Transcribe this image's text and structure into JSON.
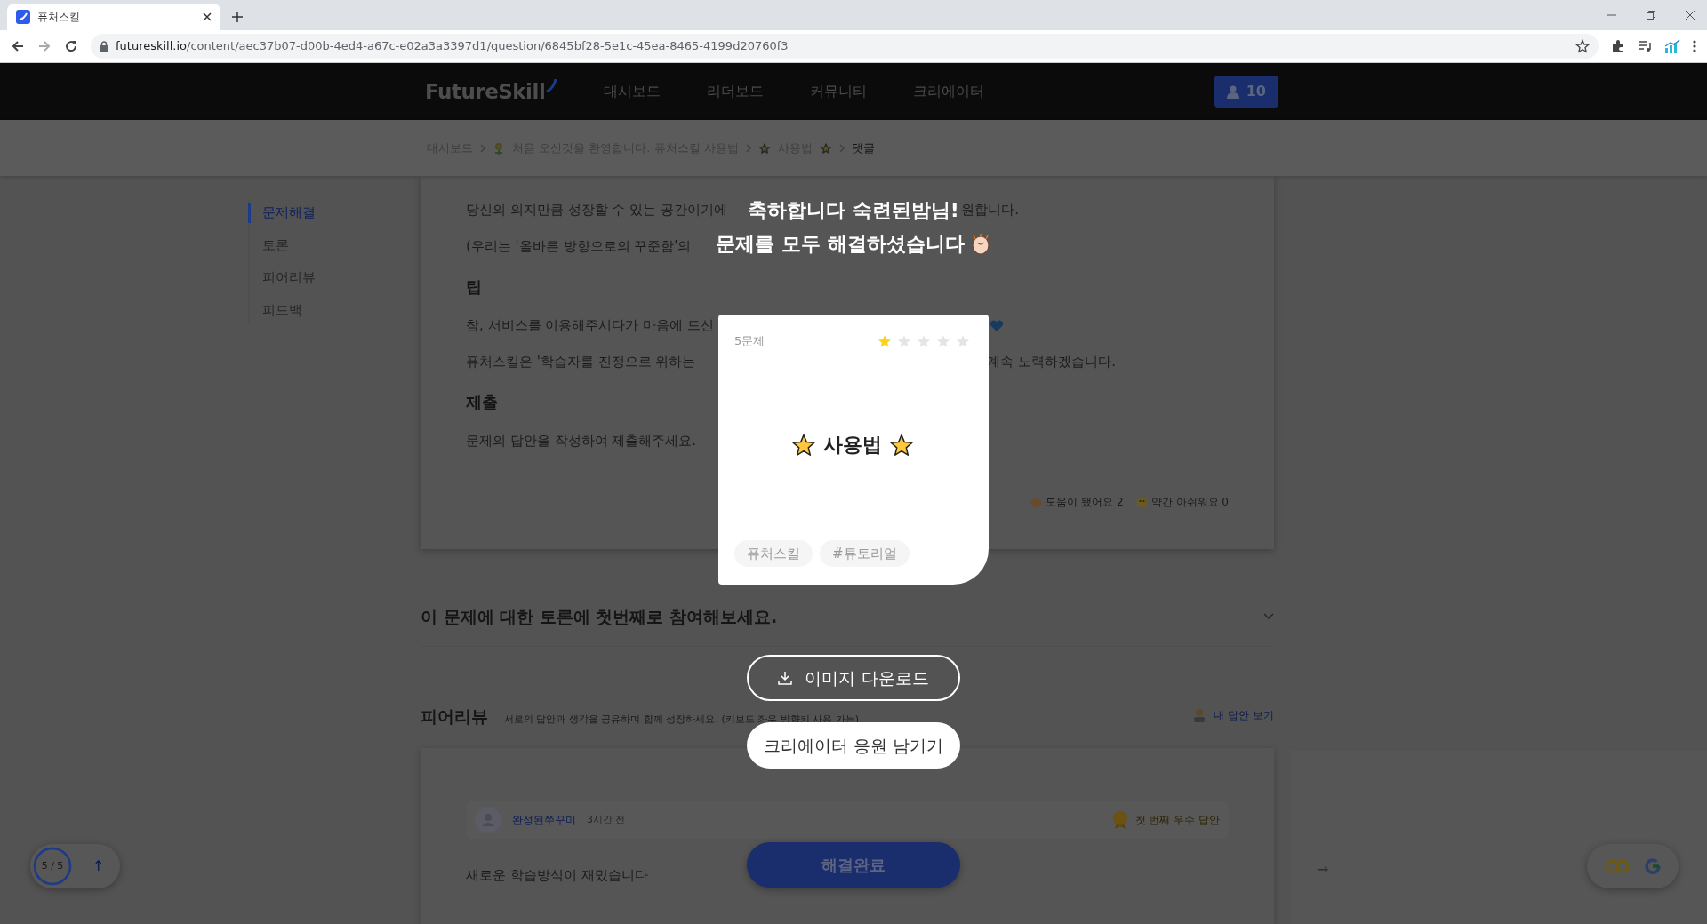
{
  "browser": {
    "tab_title": "퓨처스킬",
    "url_host": "futureskill.io",
    "url_path": "/content/aec37b07-d00b-4ed4-a67c-e02a3a3397d1/question/6845bf28-5e1c-45ea-8465-4199d20760f3"
  },
  "header": {
    "logo": "FutureSkill",
    "nav": [
      "대시보드",
      "리더보드",
      "커뮤니티",
      "크리에이터"
    ],
    "points": "10"
  },
  "breadcrumb": [
    {
      "text": "대시보드",
      "kind": "plain",
      "current": false
    },
    {
      "text": "처음 오신것을 환영합니다. 퓨처스킬 사용법",
      "kind": "flower",
      "current": false
    },
    {
      "text": "사용법",
      "kind": "starred",
      "current": false
    },
    {
      "text": "댓글",
      "kind": "plain",
      "current": true
    }
  ],
  "side_nav": [
    {
      "label": "문제해결",
      "selected": true
    },
    {
      "label": "토론",
      "selected": false
    },
    {
      "label": "피어리뷰",
      "selected": false
    },
    {
      "label": "피드백",
      "selected": false
    }
  ],
  "content": {
    "lines": [
      {
        "kind": "split",
        "left": "당신의 의지만큼 성장할 수 있는 공간이기에",
        "right": "원합니다."
      },
      {
        "kind": "text",
        "text": "(우리는 '올바른 방향으로의 꾸준함'의"
      },
      {
        "kind": "heading",
        "text": "팁"
      },
      {
        "kind": "heart",
        "text": "참, 서비스를 이용해주시다가 마음에 드신"
      },
      {
        "kind": "split",
        "left": "퓨처스킬은 '학습자를 진정으로 위하는",
        "right": "계속 노력하겠습니다."
      },
      {
        "kind": "heading",
        "text": "제출"
      },
      {
        "kind": "text",
        "text": "문제의 답안을 작성하여 제출해주세요."
      }
    ],
    "reactions": [
      {
        "kind": "clap",
        "text": "도움이 됐어요 2"
      },
      {
        "kind": "sad",
        "text": "약간 아쉬워요 0"
      }
    ]
  },
  "discussion": {
    "title": "이 문제에 대한 토론에 첫번째로 참여해보세요."
  },
  "peer_review": {
    "title": "피어리뷰",
    "subtitle": "서로의 답안과 생각을 공유하며 함께 성장하세요. (키보드 좌우 방향키 사용 가능)",
    "my_answer": "내 답안 보기",
    "review": {
      "author": "완성된쭈꾸미",
      "time": "3시간 전",
      "badge": "첫 번째 우수 답안",
      "body": "새로운 학습방식이 재밌습니다"
    },
    "next": "→"
  },
  "progress": {
    "text": "5 / 5",
    "level": 1,
    "up": "↑"
  },
  "submit_button": "해결완료",
  "modal": {
    "title_lines": [
      "축하합니다 숙련된밤님!",
      "문제를 모두 해결하셨습니다"
    ],
    "card": {
      "count": "5문제",
      "stars": 1,
      "title": "사용법",
      "tags": [
        "퓨처스킬",
        "#튜토리얼"
      ]
    },
    "buttons": [
      {
        "kind": "outline",
        "label": "이미지 다운로드"
      },
      {
        "kind": "solid",
        "label": "크리에이터 응원 남기기"
      }
    ]
  }
}
